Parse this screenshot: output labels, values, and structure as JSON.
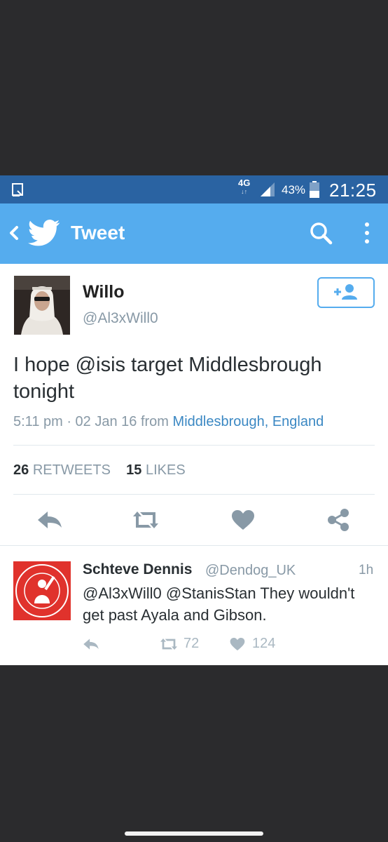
{
  "status_bar": {
    "network": "4G",
    "network_sub": "↓↑",
    "battery": "43%",
    "time": "21:25"
  },
  "app_bar": {
    "title": "Tweet"
  },
  "tweet": {
    "name": "Willo",
    "handle": "@Al3xWill0",
    "text": "I hope @isis target Middlesbrough tonight",
    "time": "5:11 pm · 02 Jan 16 from ",
    "location": "Middlesbrough, England",
    "retweet_count": "26",
    "retweet_label": "RETWEETS",
    "like_count": "15",
    "like_label": "LIKES"
  },
  "reply": {
    "name": "Schteve Dennis",
    "handle": "@Dendog_UK",
    "time": "1h",
    "text": "@Al3xWill0 @StanisStan They wouldn't get past Ayala and Gibson.",
    "retweets": "72",
    "likes": "124",
    "avatar_text_top": "GET WELL SOON ALI",
    "avatar_text_bottom": "MR MIDDLESBROUGH"
  },
  "colors": {
    "status_bar": "#2a63a2",
    "app_bar": "#55acee",
    "link": "#3b88c3",
    "muted": "#8899a6",
    "reply_avatar": "#e0322c"
  }
}
